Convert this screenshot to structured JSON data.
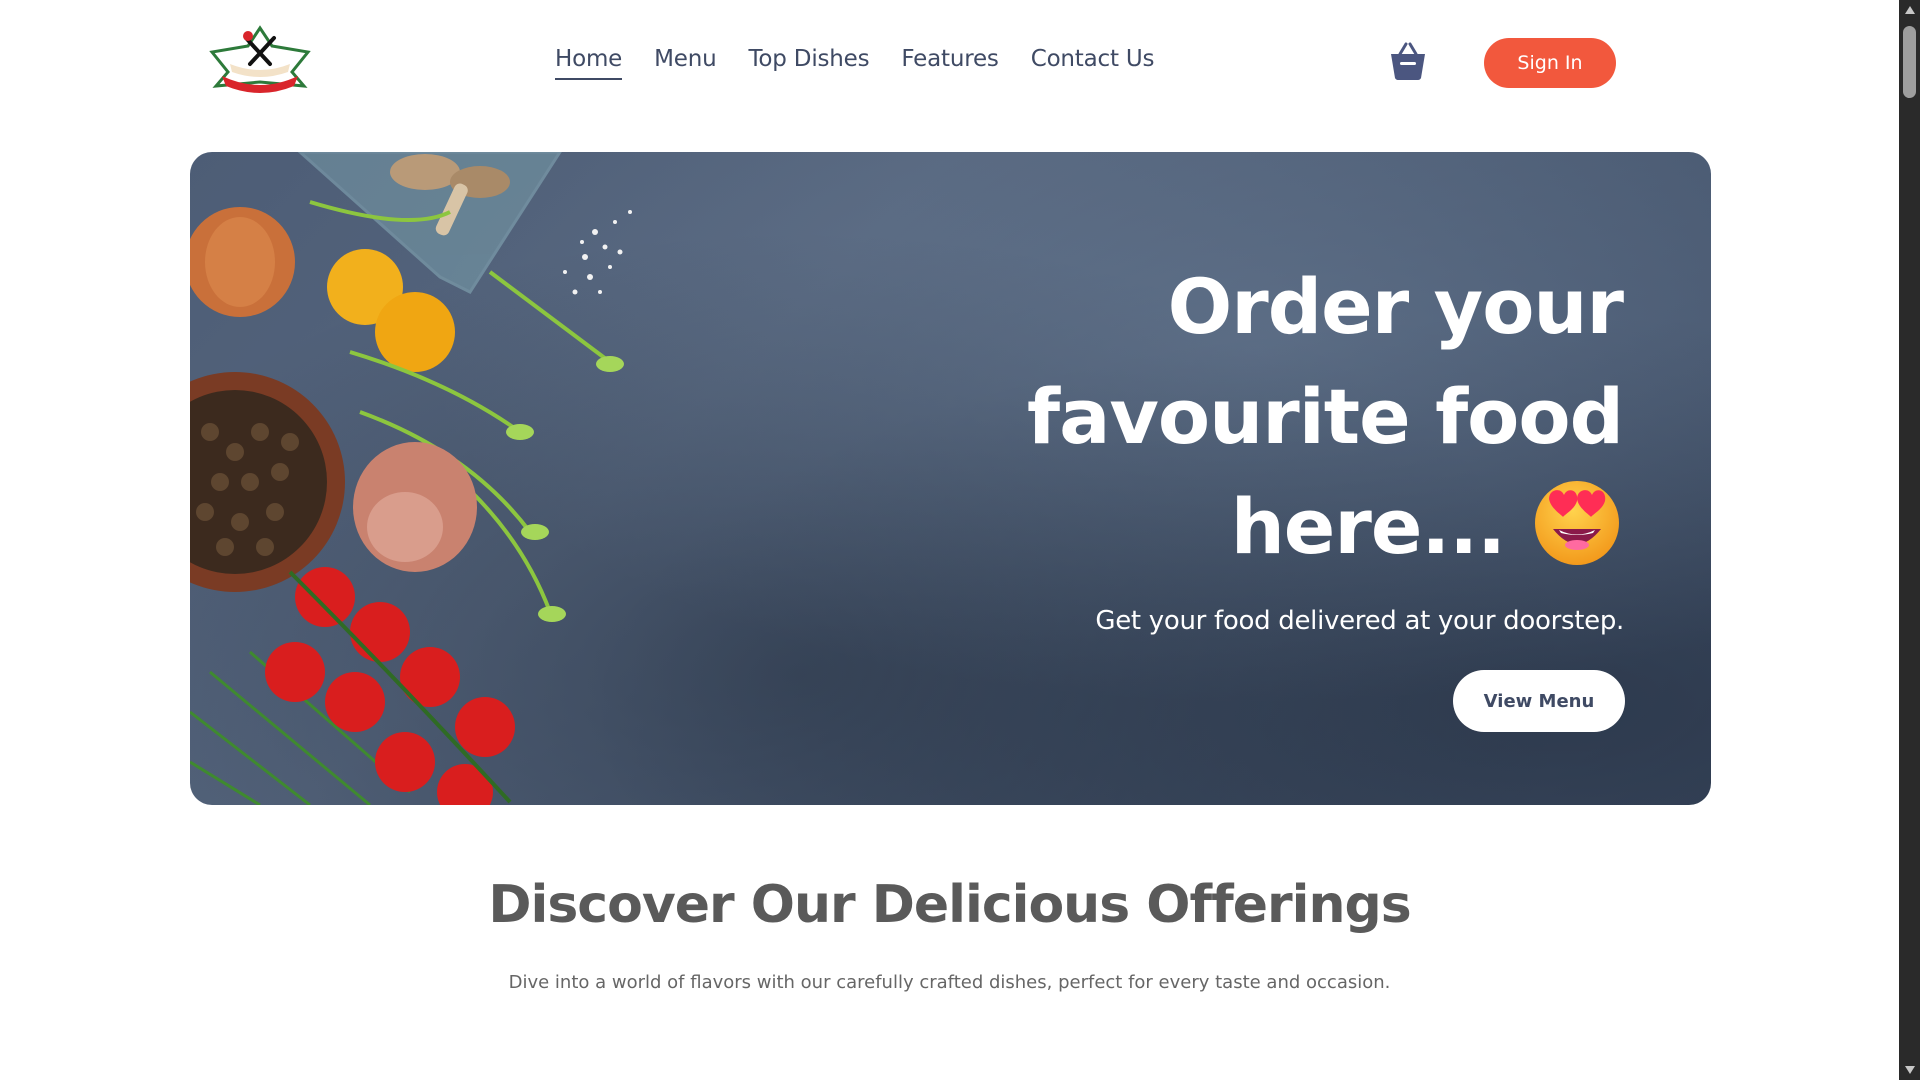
{
  "nav": {
    "links": [
      {
        "label": "Home",
        "active": true
      },
      {
        "label": "Menu",
        "active": false
      },
      {
        "label": "Top Dishes",
        "active": false
      },
      {
        "label": "Features",
        "active": false
      },
      {
        "label": "Contact Us",
        "active": false
      }
    ],
    "cart_icon": "shopping-basket-icon",
    "signin_label": "Sign In"
  },
  "hero": {
    "title": "Order your favourite food here...",
    "emoji": "smiling-face-with-heart-eyes",
    "subtitle": "Get your food delivered at your doorstep.",
    "button_label": "View Menu"
  },
  "offerings": {
    "title": "Discover Our Delicious Offerings",
    "subtitle": "Dive into a world of flavors with our carefully crafted dishes, perfect for every taste and occasion."
  },
  "colors": {
    "accent": "#f2583d",
    "nav_text": "#3f4a64",
    "hero_bg": "#4d5d76"
  }
}
